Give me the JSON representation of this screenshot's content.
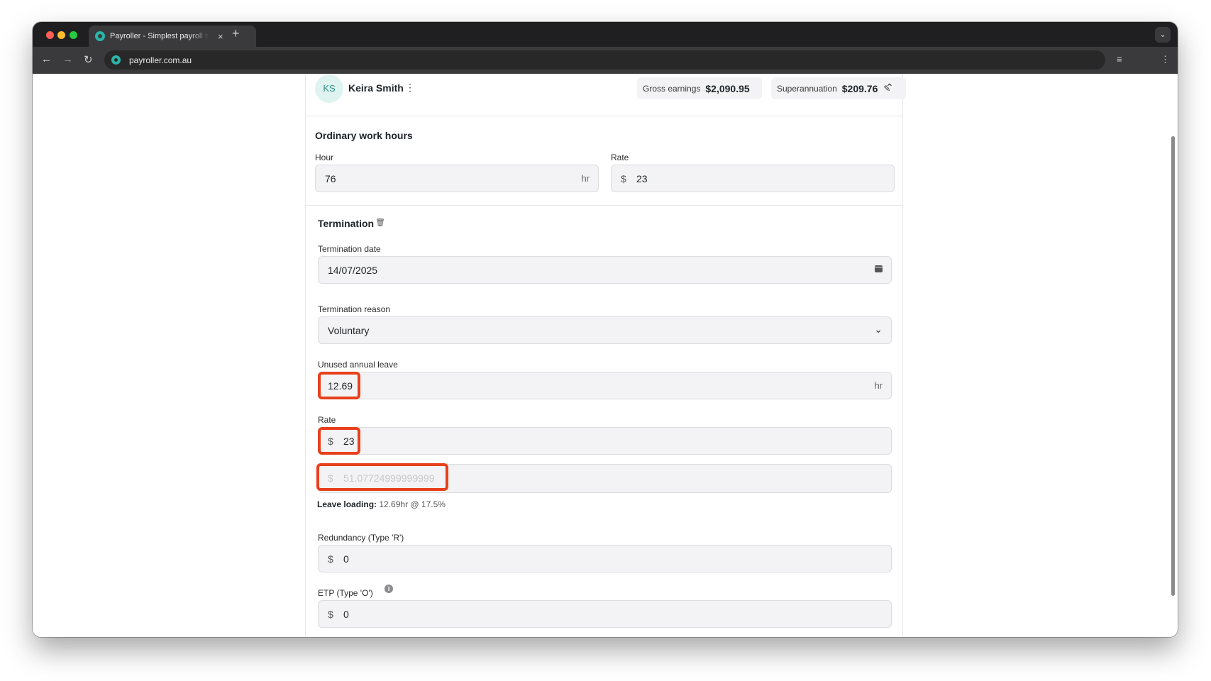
{
  "browser": {
    "tab_title": "Payroller - Simplest payroll software",
    "tab_close": "×",
    "new_tab": "+",
    "url": "payroller.com.au"
  },
  "employee": {
    "initials": "KS",
    "name": "Keira Smith",
    "gross_label": "Gross earnings",
    "gross_value": "$2,090.95",
    "super_label": "Superannuation",
    "super_value": "$209.76"
  },
  "ordinary": {
    "title": "Ordinary work hours",
    "hour_label": "Hour",
    "hour_value": "76",
    "hour_suffix": "hr",
    "rate_label": "Rate",
    "rate_prefix": "$",
    "rate_value": "23"
  },
  "termination": {
    "title": "Termination",
    "date_label": "Termination date",
    "date_value": "14/07/2025",
    "reason_label": "Termination reason",
    "reason_value": "Voluntary",
    "unused_label": "Unused annual leave",
    "unused_value": "12.69",
    "unused_suffix": "hr",
    "rate_label": "Rate",
    "rate_prefix": "$",
    "rate_value": "23",
    "loading_prefix": "$",
    "loading_value": "51.07724999999999",
    "loading_note_label": "Leave loading:",
    "loading_note_value": "12.69hr @ 17.5%",
    "redundancy_label": "Redundancy (Type 'R')",
    "redundancy_prefix": "$",
    "redundancy_value": "0",
    "etp_label": "ETP (Type 'O')",
    "etp_prefix": "$",
    "etp_value": "0"
  },
  "colors": {
    "highlight": "#e8401c",
    "brand": "#2bb5a8"
  }
}
